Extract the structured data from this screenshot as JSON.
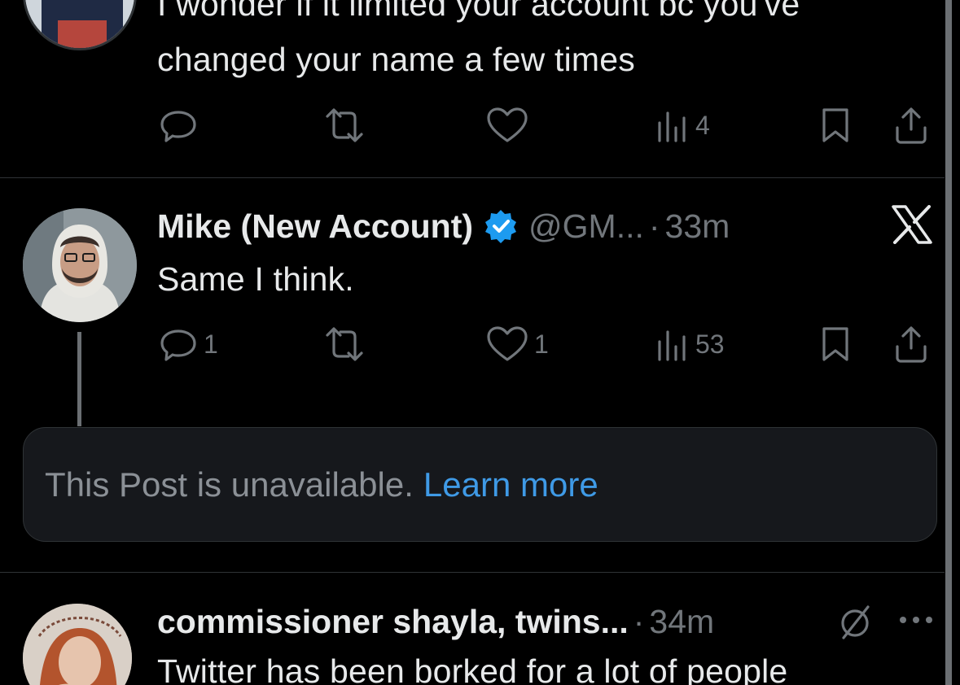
{
  "tweets": [
    {
      "text_lines": [
        "I wonder if it limited your account bc you've",
        "changed your name a few times"
      ],
      "actions": {
        "replies": "",
        "reposts": "",
        "likes": "",
        "views": "4"
      }
    },
    {
      "display_name": "Mike (New Account)",
      "handle": "@GM...",
      "separator": "·",
      "time": "33m",
      "text": "Same I think.",
      "actions": {
        "replies": "1",
        "reposts": "",
        "likes": "1",
        "views": "53"
      }
    },
    {
      "display_name": "commissioner shayla, twins...",
      "separator": "·",
      "time": "34m",
      "text": "Twitter has been borked for a lot of people"
    }
  ],
  "unavailable": {
    "message": "This Post is unavailable.",
    "link_label": "Learn more"
  },
  "colors": {
    "background": "#000000",
    "text_primary": "#e7e9ea",
    "text_secondary": "#71767b",
    "link": "#3f9ae6",
    "verified_badge": "#1d9bf0"
  }
}
